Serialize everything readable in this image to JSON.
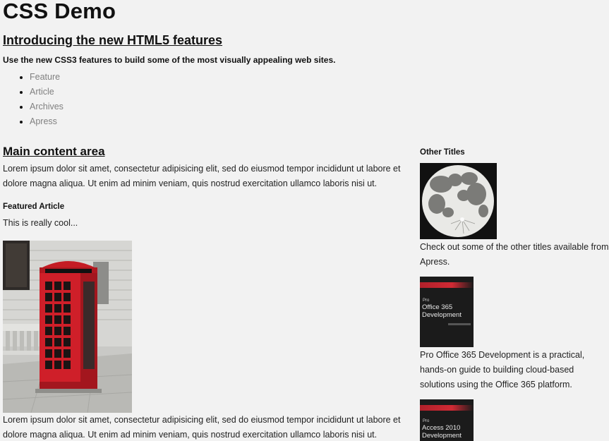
{
  "page": {
    "title": "CSS Demo"
  },
  "intro": {
    "heading": "Introducing the new HTML5 features",
    "subheading": "Use the new CSS3 features to build some of the most visually appealing web sites."
  },
  "nav": {
    "items": [
      {
        "label": "Feature"
      },
      {
        "label": "Article"
      },
      {
        "label": "Archives"
      },
      {
        "label": "Apress"
      }
    ]
  },
  "main": {
    "heading": "Main content area",
    "paragraph1": "Lorem ipsum dolor sit amet, consectetur adipisicing elit, sed do eiusmod tempor incididunt ut labore et dolore magna aliqua. Ut enim ad minim veniam, quis nostrud exercitation ullamco laboris nisi ut.",
    "featured": {
      "heading": "Featured Article",
      "text": "This is really cool...",
      "image_icon": "phone-box-photo"
    },
    "paragraph2": "Lorem ipsum dolor sit amet, consectetur adipisicing elit, sed do eiusmod tempor incididunt ut labore et dolore magna aliqua. Ut enim ad minim veniam, quis nostrud exercitation ullamco laboris nisi ut."
  },
  "sidebar": {
    "heading": "Other Titles",
    "moon_text": "Check out some of the other titles available from Apress.",
    "books": [
      {
        "pro": "Pro",
        "title": "Office 365 Development",
        "description": "Pro Office 365 Development is a practical, hands-on guide to building cloud-based solutions using the Office 365 platform."
      },
      {
        "pro": "Pro",
        "title": "Access 2010 Development"
      }
    ]
  },
  "colors": {
    "background": "#f2f2f2",
    "nav_link": "#808080",
    "phone_box_red": "#d0202a",
    "book_cover": "#1b1b1b",
    "book_stripe": "#b0202a"
  }
}
